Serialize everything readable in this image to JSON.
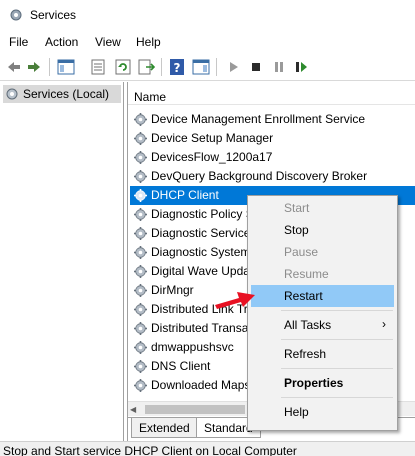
{
  "window": {
    "title": "Services"
  },
  "menu": [
    "File",
    "Action",
    "View",
    "Help"
  ],
  "toolbar": {
    "icons": [
      "back-icon",
      "forward-icon",
      "console-tree-icon",
      "properties-icon",
      "refresh-icon",
      "export-list-icon",
      "help-icon",
      "show-action-pane-icon",
      "start-icon",
      "stop-icon",
      "pause-icon",
      "restart-icon"
    ]
  },
  "tree": {
    "label": "Services (Local)"
  },
  "columns": {
    "name": "Name"
  },
  "services": [
    "Device Management Enrollment Service",
    "Device Setup Manager",
    "DevicesFlow_1200a17",
    "DevQuery Background Discovery Broker",
    "DHCP Client",
    "Diagnostic Policy S",
    "Diagnostic Service",
    "Diagnostic System",
    "Digital Wave Upda",
    "DirMngr",
    "Distributed Link Tr",
    "Distributed Transa",
    "dmwappushsvc",
    "DNS Client",
    "Downloaded Maps"
  ],
  "selected_service": "DHCP Client",
  "tabs": {
    "extended": "Extended",
    "standard": "Standard"
  },
  "status": "Stop and Start service DHCP Client on Local Computer",
  "context_menu": {
    "start": "Start",
    "stop": "Stop",
    "pause": "Pause",
    "resume": "Resume",
    "restart": "Restart",
    "all_tasks": "All Tasks",
    "refresh": "Refresh",
    "properties": "Properties",
    "help": "Help"
  },
  "colors": {
    "selection": "#0078d7",
    "menu_hover": "#91c9f7",
    "pointer": "#e81123"
  }
}
